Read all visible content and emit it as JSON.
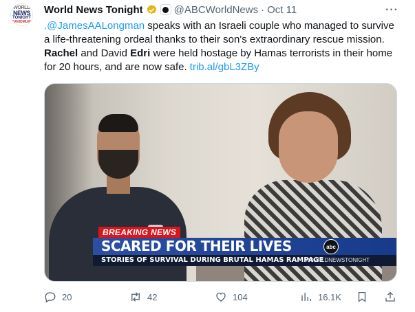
{
  "tweet": {
    "author": {
      "display_name": "World News Tonight",
      "handle": "@ABCWorldNews",
      "separator": "·",
      "date": "Oct 11",
      "avatar_lines": [
        "WORLD",
        "NEWS",
        "TONIGHT",
        "DAVIDMUIR"
      ]
    },
    "text": {
      "mention": ".@JamesAALongman",
      "part1": " speaks with an Israeli couple who managed to survive a life-threatening ordeal thanks to their son's extraordinary rescue mission. ",
      "bold1": "Rachel",
      "part2": " and David ",
      "bold2": "Edri",
      "part3": " were held hostage by Hamas terrorists in their home for 20 hours, and are now safe. ",
      "link": "trib.al/gbL3ZBy"
    },
    "media": {
      "breaking_label": "BREAKING NEWS",
      "headline": "SCARED FOR THEIR LIVES",
      "subheadline": "STORIES OF SURVIVAL DURING BRUTAL HAMAS RAMPAGE",
      "hashtag": "#WORLDNEWSTONIGHT",
      "network_logo": "abc"
    },
    "actions": {
      "replies": "20",
      "reposts": "42",
      "likes": "104",
      "views": "16.1K"
    }
  },
  "colors": {
    "link": "#1d9bf0",
    "verified_gold": "#e2b719",
    "muted": "#536471",
    "breaking_red": "#d8161d",
    "headline_blue": "#2b4fa3"
  }
}
